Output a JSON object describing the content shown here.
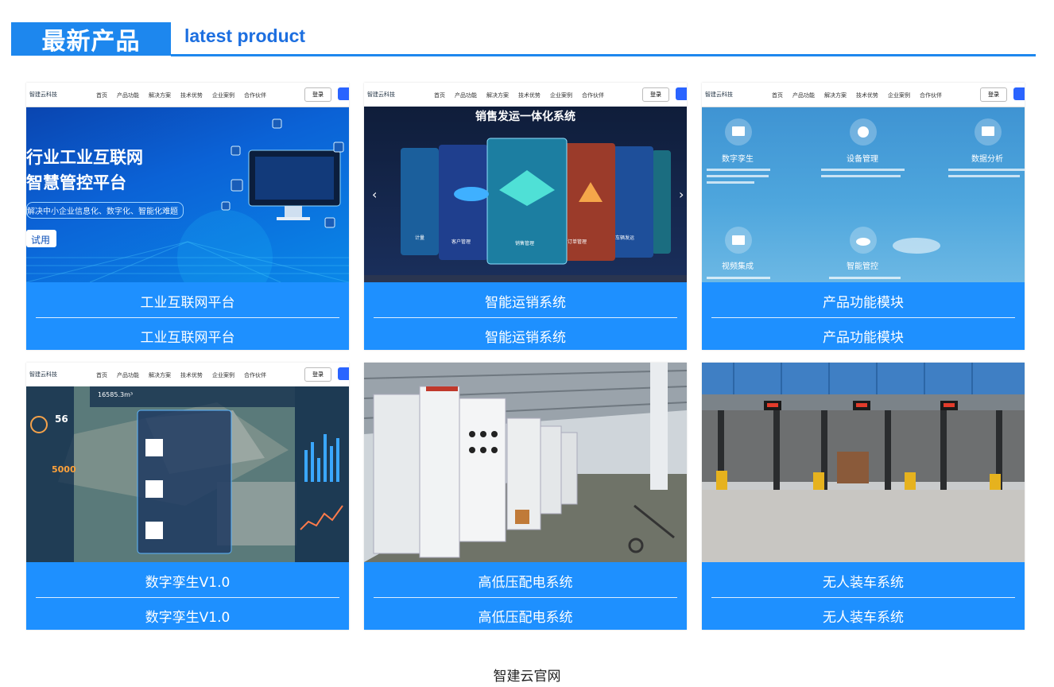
{
  "section": {
    "title_zh": "最新产品",
    "title_en": "latest product"
  },
  "mini_site": {
    "logo": "智建云科技",
    "nav": [
      "首页",
      "产品功能",
      "解决方案",
      "技术优势",
      "企业案例",
      "合作伙伴"
    ],
    "login": "登录"
  },
  "products": [
    {
      "caption": "工业互联网平台",
      "subcaption": "工业互联网平台",
      "banner_line1": "行业工业互联网",
      "banner_line2": "智慧管控平台",
      "banner_line3": "解决中小企业信息化、数字化、智能化难题",
      "banner_button": "试用"
    },
    {
      "caption": "智能运销系统",
      "subcaption": "智能运销系统",
      "banner_title": "销售发运一体化系统",
      "banner_labels": [
        "计量",
        "客户管理",
        "销售管理",
        "订单管理",
        "车辆发运"
      ]
    },
    {
      "caption": "产品功能模块",
      "subcaption": "产品功能模块",
      "modules": [
        "数字孪生",
        "设备管理",
        "数据分析",
        "视频集成",
        "智能管控"
      ]
    },
    {
      "caption": "数字孪生V1.0",
      "subcaption": "数字孪生V1.0",
      "stat_big": "56",
      "stat_num": "5000",
      "stat_top": "16585.3m³"
    },
    {
      "caption": "高低压配电系统",
      "subcaption": "高低压配电系统"
    },
    {
      "caption": "无人装车系统",
      "subcaption": "无人装车系统"
    }
  ],
  "footer": {
    "text": "智建云官网"
  }
}
